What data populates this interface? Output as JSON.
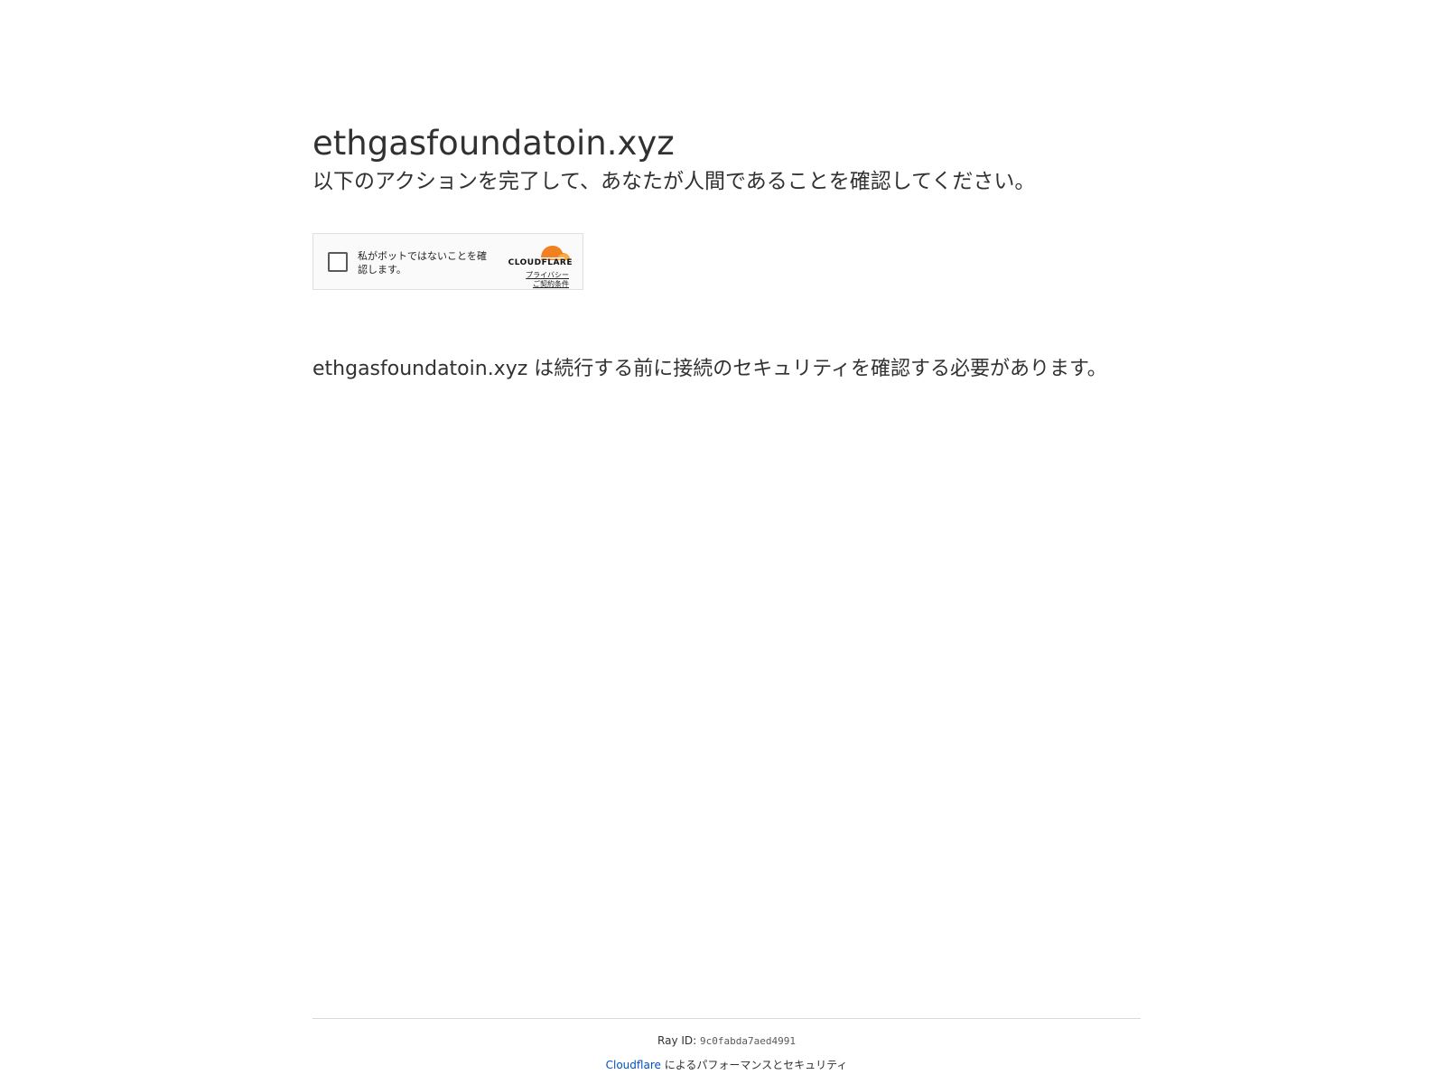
{
  "site": {
    "domain": "ethgasfoundatoin.xyz",
    "subtitle": "以下のアクションを完了して、あなたが人間であることを確認してください。"
  },
  "widget": {
    "checkbox_label": "私がボットではないことを確認します。",
    "checked": false,
    "brand": "CLOUDFLARE",
    "privacy_link": "プライバシー",
    "terms_link": "ご契約条件",
    "brand_colors": {
      "cloud_orange": "#f38020",
      "cloud_light": "#faad3f"
    }
  },
  "body": {
    "domain": "ethgasfoundatoin.xyz",
    "message": " は続行する前に接続のセキュリティを確認する必要があります。"
  },
  "footer": {
    "ray_label": "Ray ID:",
    "ray_id": "9c0fabda7aed4991",
    "performance_link": "Cloudflare",
    "performance_text": " によるパフォーマンスとセキュリティ",
    "link_color": "#0051c3"
  }
}
